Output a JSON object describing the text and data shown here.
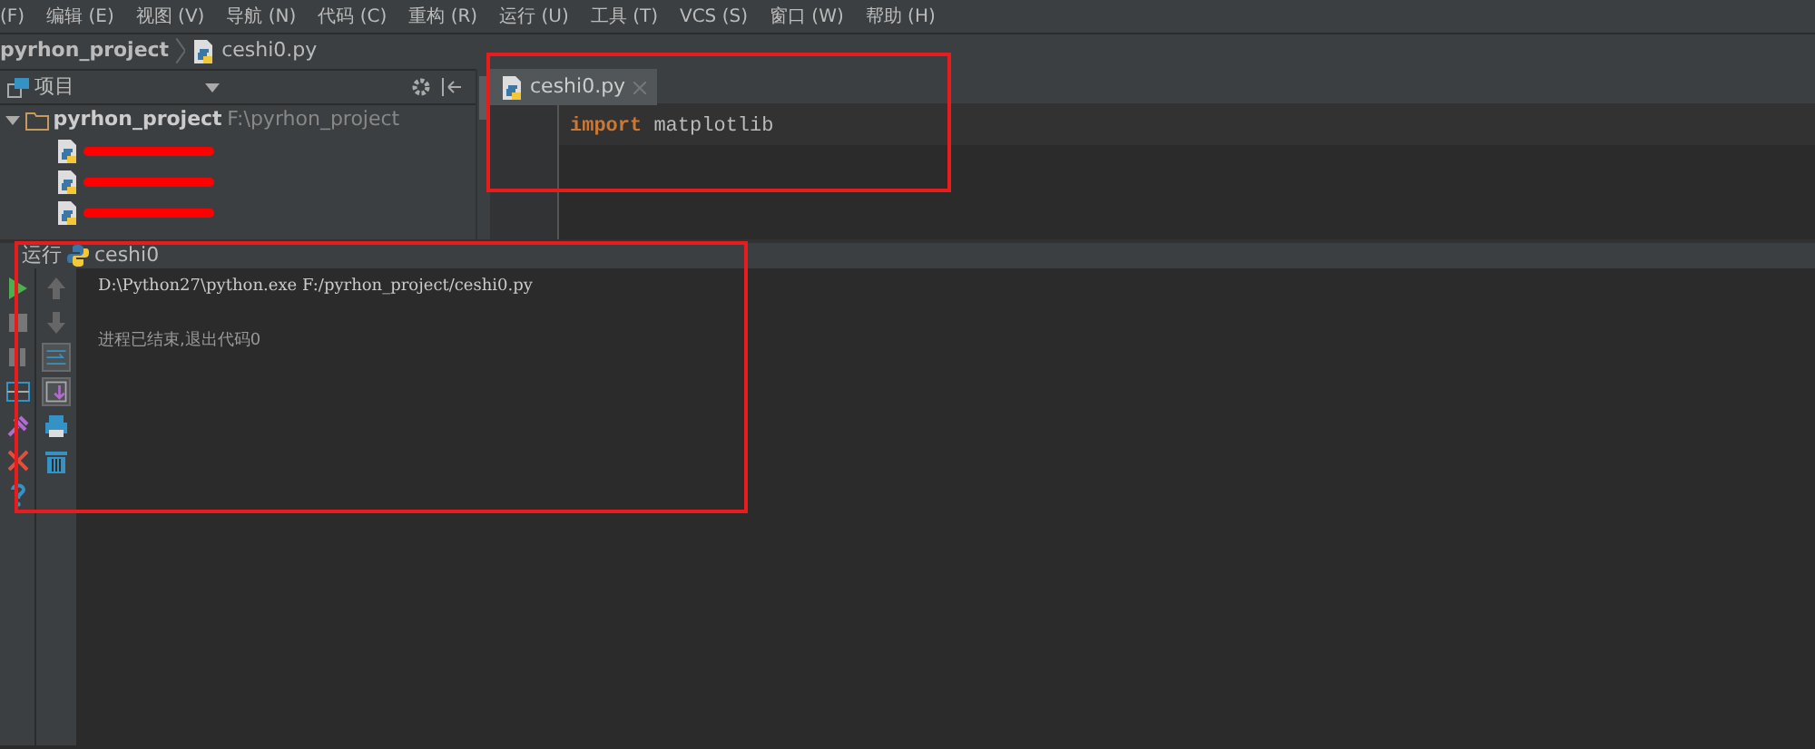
{
  "menu": [
    "(F)",
    "编辑 (E)",
    "视图 (V)",
    "导航 (N)",
    "代码 (C)",
    "重构 (R)",
    "运行 (U)",
    "工具 (T)",
    "VCS (S)",
    "窗口 (W)",
    "帮助 (H)"
  ],
  "breadcrumb": [
    "pyrhon_project",
    "ceshi0.py"
  ],
  "project_panel": {
    "title": "项目",
    "root": {
      "name": "pyrhon_project",
      "path": "F:\\pyrhon_project",
      "expanded": true,
      "children": [
        {
          "redacted": true
        },
        {
          "redacted": true
        },
        {
          "redacted": true
        }
      ]
    }
  },
  "editor": {
    "tabs": [
      {
        "label": "ceshi0.py",
        "selected": true
      }
    ],
    "code": [
      {
        "keyword": "import",
        "rest": " matplotlib"
      }
    ]
  },
  "run_panel": {
    "title": "运行",
    "config": "ceshi0",
    "output": [
      {
        "kind": "command",
        "text": "D:\\Python27\\python.exe F:/pyrhon_project/ceshi0.py"
      },
      {
        "kind": "status",
        "text": "进程已结束,退出代码0"
      }
    ]
  }
}
